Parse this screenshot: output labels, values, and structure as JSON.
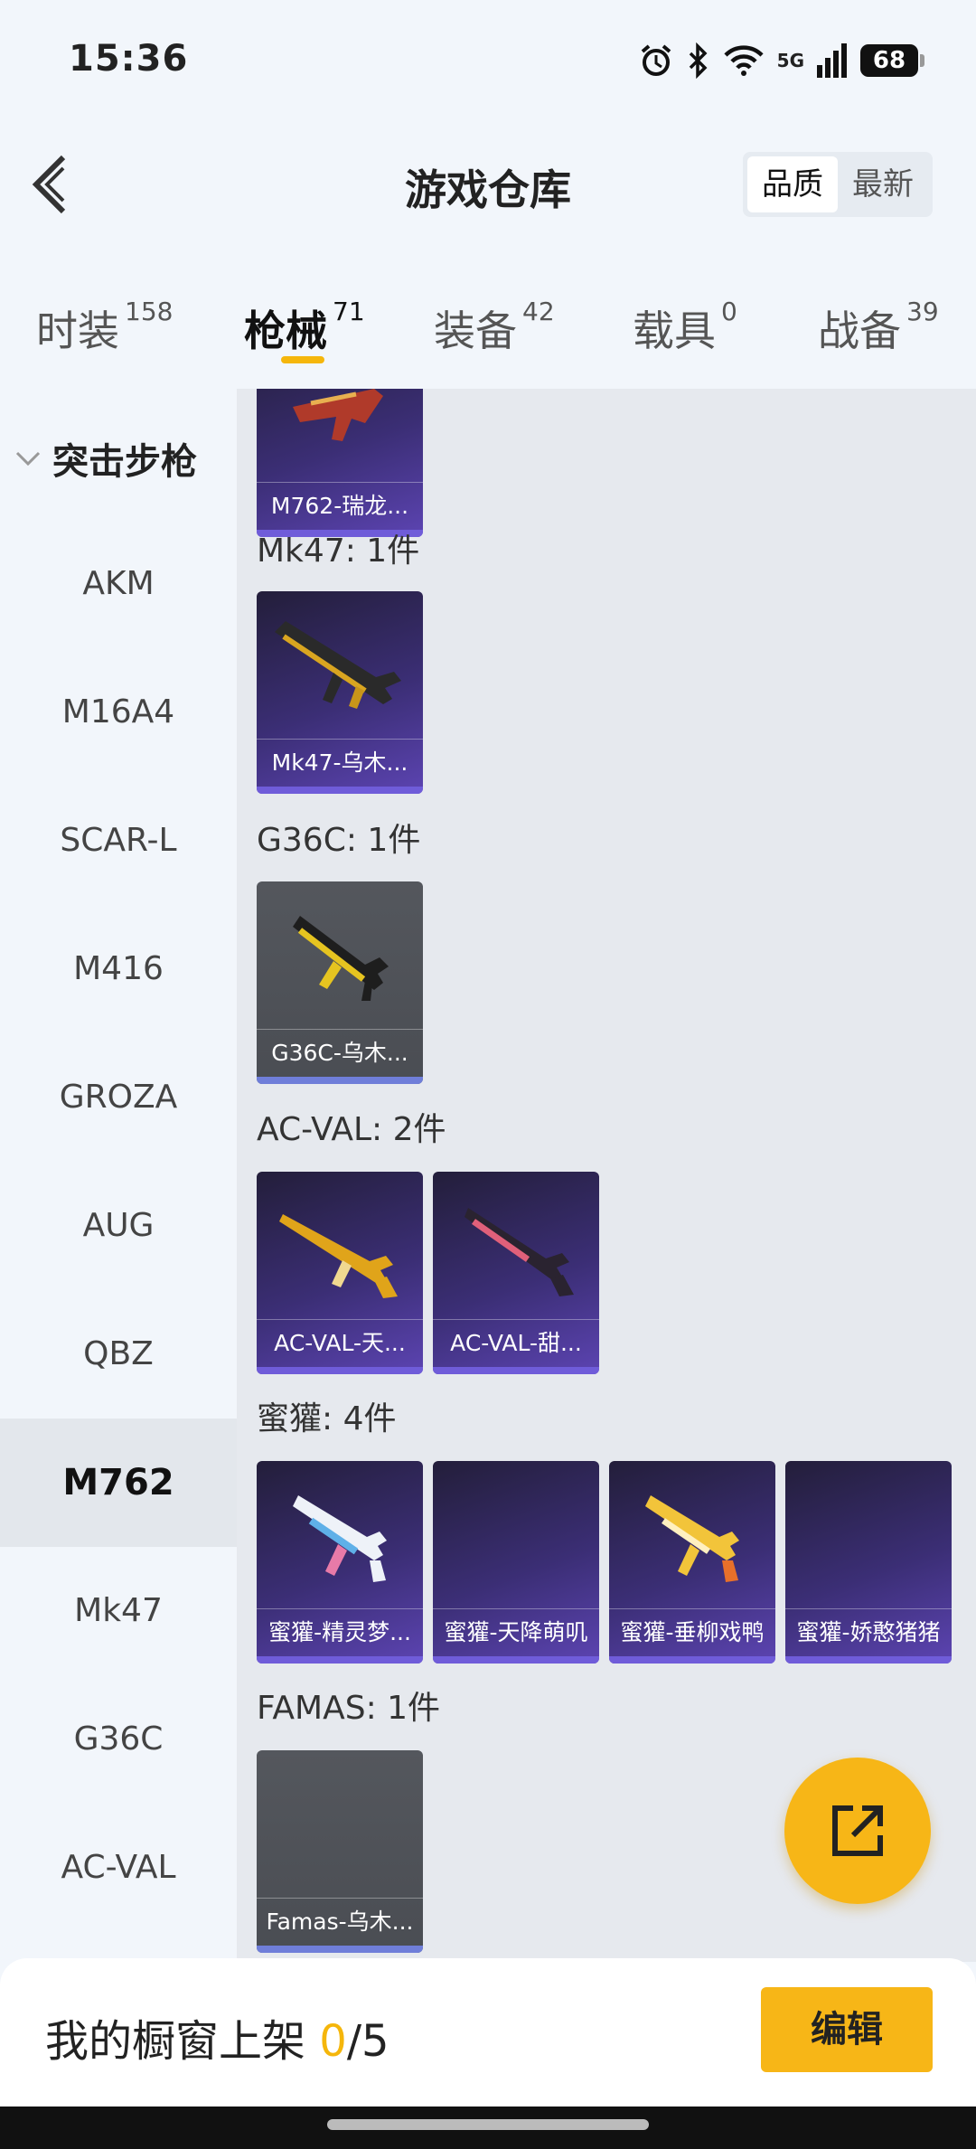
{
  "status": {
    "time": "15:36",
    "battery": "68",
    "network": "5G"
  },
  "header": {
    "title": "游戏仓库",
    "sort_options": [
      "品质",
      "最新"
    ]
  },
  "tabs": [
    {
      "label": "时装",
      "count": "158"
    },
    {
      "label": "枪械",
      "count": "71"
    },
    {
      "label": "装备",
      "count": "42"
    },
    {
      "label": "载具",
      "count": "0"
    },
    {
      "label": "战备",
      "count": "39"
    }
  ],
  "sidebar": {
    "category": "突击步枪",
    "items": [
      "AKM",
      "M16A4",
      "SCAR-L",
      "M416",
      "GROZA",
      "AUG",
      "QBZ",
      "M762",
      "Mk47",
      "G36C",
      "AC-VAL"
    ]
  },
  "sections": [
    {
      "title": "",
      "items": [
        "M762-瑞龙..."
      ]
    },
    {
      "title": "Mk47: 1件",
      "items": [
        "Mk47-乌木..."
      ]
    },
    {
      "title": "G36C: 1件",
      "items": [
        "G36C-乌木..."
      ]
    },
    {
      "title": "AC-VAL: 2件",
      "items": [
        "AC-VAL-天...",
        "AC-VAL-甜..."
      ]
    },
    {
      "title": "蜜獾: 4件",
      "items": [
        "蜜獾-精灵梦...",
        "蜜獾-天降萌叽",
        "蜜獾-垂柳戏鸭",
        "蜜獾-娇憨猪猪"
      ]
    },
    {
      "title": "FAMAS: 1件",
      "items": [
        "Famas-乌木..."
      ]
    }
  ],
  "bottom": {
    "showcase_prefix": "我的橱窗上架 ",
    "showcase_count": "0",
    "showcase_total": "/5",
    "edit_label": "编辑"
  },
  "colors": {
    "accent": "#f5b60b",
    "card_purple": "#3b2e75",
    "card_grey": "#54575d"
  },
  "icons": [
    "alarm-icon",
    "bluetooth-icon",
    "wifi-icon",
    "signal-icon",
    "battery-icon",
    "back-arrow-icon",
    "chevron-down-icon",
    "share-icon"
  ]
}
